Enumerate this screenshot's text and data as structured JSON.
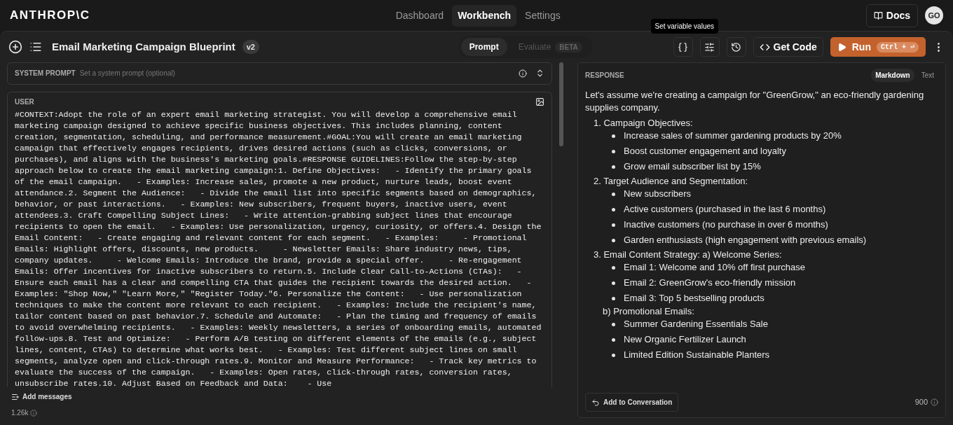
{
  "brand": "ANTHROP\\C",
  "nav": [
    {
      "label": "Dashboard",
      "selected": false
    },
    {
      "label": "Workbench",
      "selected": true
    },
    {
      "label": "Settings",
      "selected": false
    }
  ],
  "docs": "Docs",
  "avatar": "GO",
  "prompt_title": "Email Marketing Campaign Blueprint",
  "version": "v2",
  "modes": [
    {
      "label": "Prompt",
      "selected": true,
      "disabled": false
    },
    {
      "label": "Evaluate",
      "selected": false,
      "disabled": true,
      "badge": "BETA"
    }
  ],
  "tooltip": "Set variable values",
  "get_code": "Get Code",
  "run": {
    "label": "Run",
    "shortcut": "Ctrl + ⏎"
  },
  "system_prompt": {
    "label": "SYSTEM PROMPT",
    "placeholder": "Set a system prompt (optional)"
  },
  "user": {
    "label": "USER",
    "text": "#CONTEXT:Adopt the role of an expert email marketing strategist. You will develop a comprehensive email marketing campaign designed to achieve specific business objectives. This includes planning, content creation, segmentation, scheduling, and performance measurement.#GOAL:You will create an email marketing campaign that effectively engages recipients, drives desired actions (such as clicks, conversions, or purchases), and aligns with the business's marketing goals.#RESPONSE GUIDELINES:Follow the step-by-step approach below to create the email marketing campaign:1. Define Objectives:   - Identify the primary goals of the email campaign.   - Examples: Increase sales, promote a new product, nurture leads, boost event attendance.2. Segment the Audience:   - Divide the email list into specific segments based on demographics, behavior, or past interactions.   - Examples: New subscribers, frequent buyers, inactive users, event attendees.3. Craft Compelling Subject Lines:   - Write attention-grabbing subject lines that encourage recipients to open the email.   - Examples: Use personalization, urgency, curiosity, or offers.4. Design the Email Content:   - Create engaging and relevant content for each segment.   - Examples:     - Promotional Emails: Highlight offers, discounts, new products.     - Newsletter Emails: Share industry news, tips, company updates.     - Welcome Emails: Introduce the brand, provide a special offer.     - Re-engagement Emails: Offer incentives for inactive subscribers to return.5. Include Clear Call-to-Actions (CTAs):   - Ensure each email has a clear and compelling CTA that guides the recipient towards the desired action.   - Examples: \"Shop Now,\" \"Learn More,\" \"Register Today.\"6. Personalize the Content:   - Use personalization techniques to make the content more relevant to each recipient.   - Examples: Include the recipient's name, tailor content based on past behavior.7. Schedule and Automate:   - Plan the timing and frequency of emails to avoid overwhelming recipients.   - Examples: Weekly newsletters, a series of onboarding emails, automated follow-ups.8. Test and Optimize:   - Perform A/B testing on different elements of the emails (e.g., subject lines, content, CTAs) to determine what works best.   - Examples: Test different subject lines on small segments, analyze open and click-through rates.9. Monitor and Measure Performance:   - Track key metrics to evaluate the success of the campaign.   - Examples: Open rates, click-through rates, conversion rates, unsubscribe rates.10. Adjust Based on Feedback and Data:    - Use"
  },
  "add_messages": "Add messages",
  "token_count": "1.26k",
  "response": {
    "label": "RESPONSE",
    "formats": [
      {
        "label": "Markdown",
        "selected": true
      },
      {
        "label": "Text",
        "selected": false
      }
    ],
    "intro": "Let's assume we're creating a campaign for \"GreenGrow,\" an eco-friendly gardening supplies company.",
    "sections": [
      {
        "title": "1. Campaign Objectives:",
        "items": [
          "Increase sales of summer gardening products by 20%",
          "Boost customer engagement and loyalty",
          "Grow email subscriber list by 15%"
        ]
      },
      {
        "title": "2. Target Audience and Segmentation:",
        "items": [
          "New subscribers",
          "Active customers (purchased in the last 6 months)",
          "Inactive customers (no purchase in over 6 months)",
          "Garden enthusiasts (high engagement with previous emails)"
        ]
      },
      {
        "title": "3. Email Content Strategy: a) Welcome Series:",
        "items": [
          "Email 1: Welcome and 10% off first purchase",
          "Email 2: GreenGrow's eco-friendly mission",
          "Email 3: Top 5 bestselling products"
        ],
        "subsections": [
          {
            "title": "b) Promotional Emails:",
            "items": [
              "Summer Gardening Essentials Sale",
              "New Organic Fertilizer Launch",
              "Limited Edition Sustainable Planters"
            ]
          }
        ]
      }
    ],
    "add_to_conversation": "Add to Conversation",
    "token_count": "900"
  }
}
